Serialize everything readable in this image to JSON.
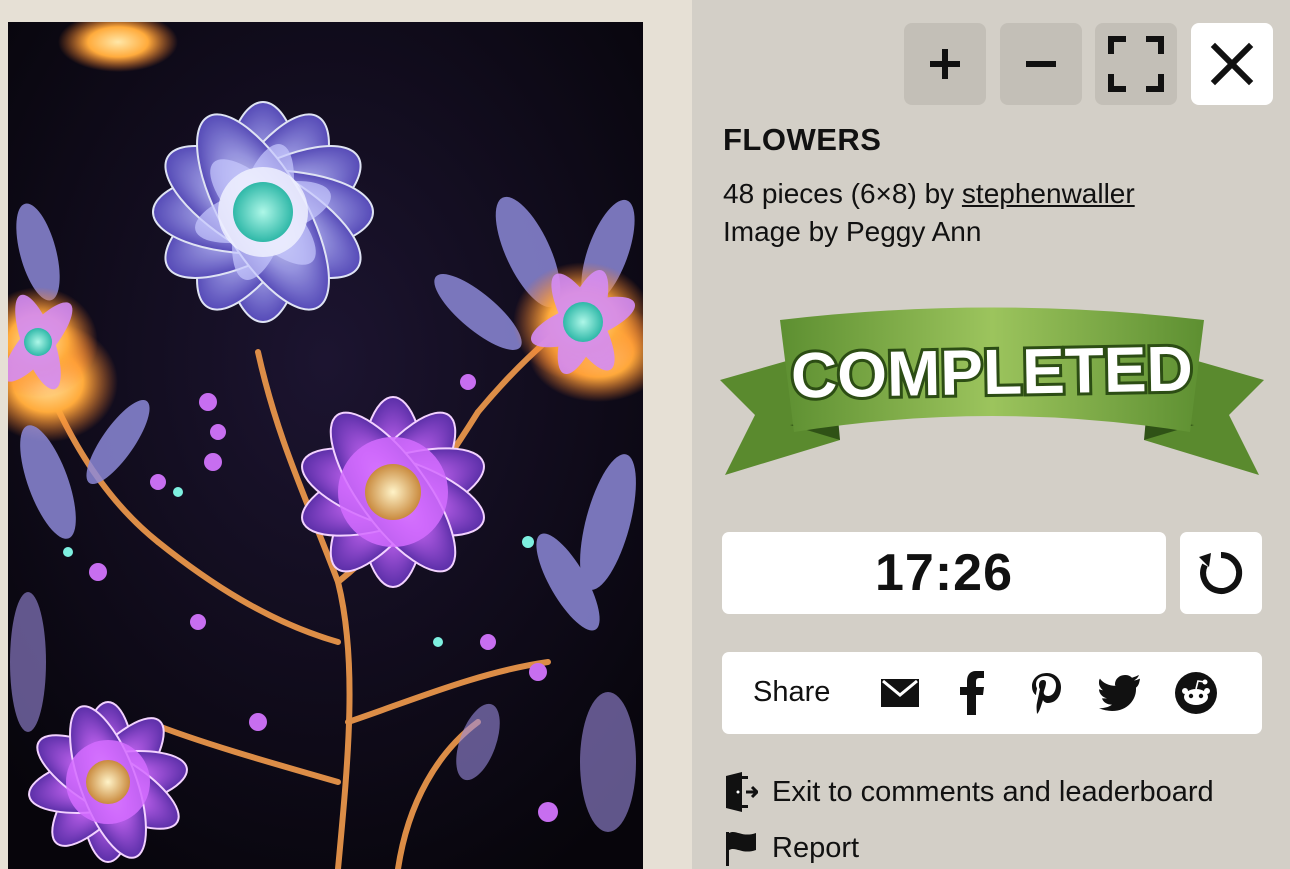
{
  "puzzle": {
    "title": "FLOWERS",
    "pieces_text": "48 pieces (6×8) by",
    "author": "stephenwaller",
    "image_credit": "Image by Peggy Ann",
    "status_banner": "COMPLETED",
    "timer": "17:26"
  },
  "controls": {
    "zoom_in_icon": "plus-icon",
    "zoom_out_icon": "minus-icon",
    "fullscreen_icon": "fullscreen-icon",
    "close_icon": "close-icon"
  },
  "share": {
    "label": "Share",
    "icons": [
      "email-icon",
      "facebook-icon",
      "pinterest-icon",
      "twitter-icon",
      "reddit-icon"
    ]
  },
  "links": {
    "exit": "Exit to comments and leaderboard",
    "report": "Report"
  },
  "colors": {
    "panel_bg": "#d3cfc7",
    "page_bg": "#e6e0d5",
    "banner_green": "#6a9a3a",
    "banner_dark": "#3f6a22"
  }
}
